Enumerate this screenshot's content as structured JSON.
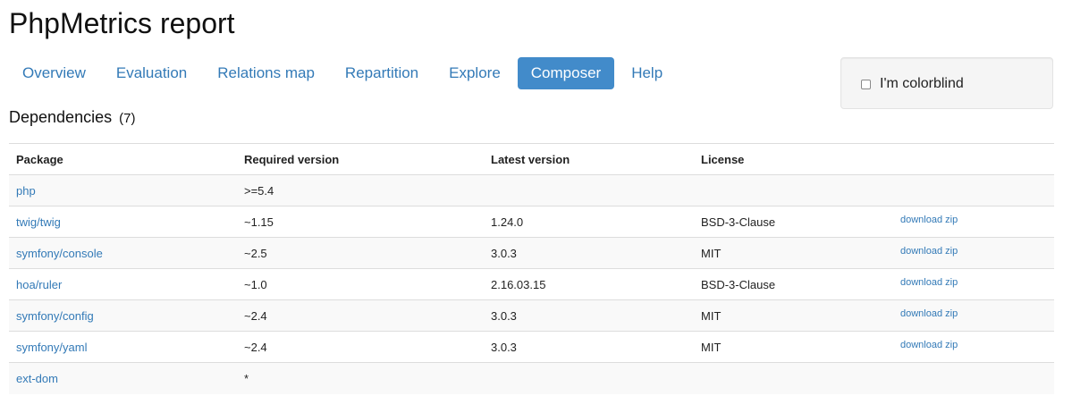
{
  "header": {
    "title": "PhpMetrics report"
  },
  "nav": {
    "tabs": [
      {
        "label": "Overview",
        "active": false
      },
      {
        "label": "Evaluation",
        "active": false
      },
      {
        "label": "Relations map",
        "active": false
      },
      {
        "label": "Repartition",
        "active": false
      },
      {
        "label": "Explore",
        "active": false
      },
      {
        "label": "Composer",
        "active": true
      },
      {
        "label": "Help",
        "active": false
      }
    ],
    "active_color": "#428bca",
    "link_color": "#337ab7"
  },
  "colorblind": {
    "label": "I'm colorblind",
    "checked": false
  },
  "dependencies": {
    "title": "Dependencies",
    "count": "(7)",
    "columns": {
      "package": "Package",
      "required": "Required version",
      "latest": "Latest version",
      "license": "License",
      "download": ""
    },
    "rows": [
      {
        "package": "php",
        "required": ">=5.4",
        "latest": "",
        "license": "",
        "download": ""
      },
      {
        "package": "twig/twig",
        "required": "~1.15",
        "latest": "1.24.0",
        "license": "BSD-3-Clause",
        "download": "download zip"
      },
      {
        "package": "symfony/console",
        "required": "~2.5",
        "latest": "3.0.3",
        "license": "MIT",
        "download": "download zip"
      },
      {
        "package": "hoa/ruler",
        "required": "~1.0",
        "latest": "2.16.03.15",
        "license": "BSD-3-Clause",
        "download": "download zip"
      },
      {
        "package": "symfony/config",
        "required": "~2.4",
        "latest": "3.0.3",
        "license": "MIT",
        "download": "download zip"
      },
      {
        "package": "symfony/yaml",
        "required": "~2.4",
        "latest": "3.0.3",
        "license": "MIT",
        "download": "download zip"
      },
      {
        "package": "ext-dom",
        "required": "*",
        "latest": "",
        "license": "",
        "download": ""
      }
    ]
  }
}
